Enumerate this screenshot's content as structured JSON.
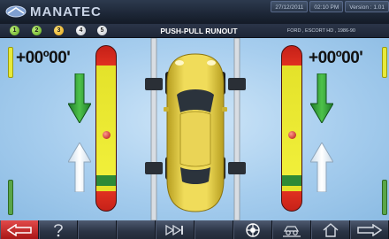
{
  "header": {
    "brand": "MANATEC",
    "date": "27/12/2011",
    "time": "02:10 PM",
    "version": "Version : 1.01"
  },
  "steps": [
    "1",
    "2",
    "3",
    "4",
    "5"
  ],
  "title": "PUSH-PULL RUNOUT",
  "vehicle": "FORD , ESCORT HD , 1986-90",
  "left_value": "+00º00'",
  "right_value": "+00º00'",
  "colors": {
    "gauge_red": "#e03020",
    "gauge_yellow": "#f1ef3a",
    "gauge_green": "#2e8a36",
    "car_yellow": "#e3cf4a"
  },
  "footer_buttons": [
    {
      "icon": "back-arrow-icon"
    },
    {
      "icon": "help-icon"
    },
    {
      "icon": "blank"
    },
    {
      "icon": "blank"
    },
    {
      "icon": "skip-forward-icon"
    },
    {
      "icon": "blank"
    },
    {
      "icon": "wheel-icon"
    },
    {
      "icon": "vehicle-lift-icon"
    },
    {
      "icon": "home-icon"
    },
    {
      "icon": "next-arrow-icon"
    }
  ]
}
